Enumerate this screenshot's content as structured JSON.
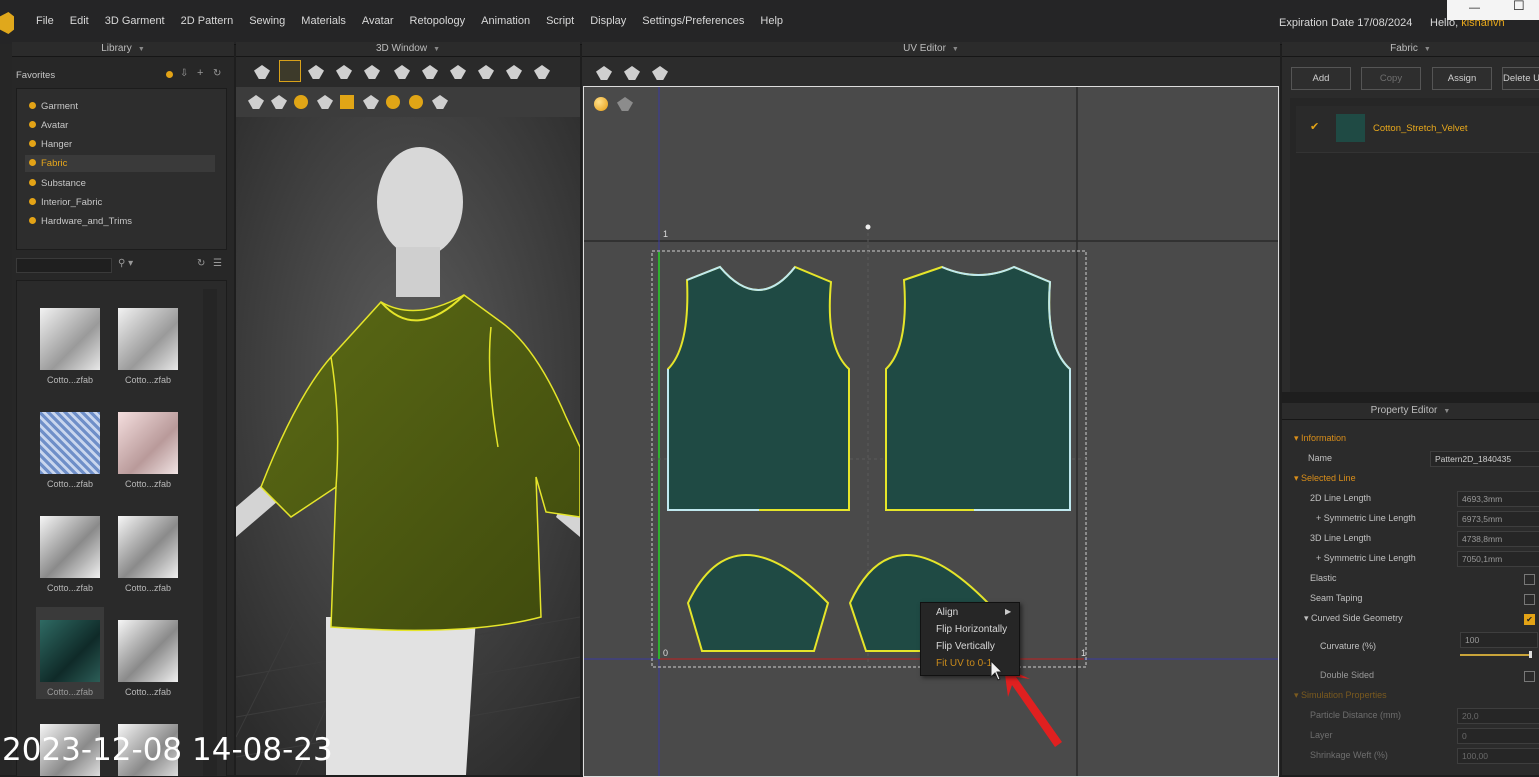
{
  "menubar": {
    "items": [
      "File",
      "Edit",
      "3D Garment",
      "2D Pattern",
      "Sewing",
      "Materials",
      "Avatar",
      "Retopology",
      "Animation",
      "Script",
      "Display",
      "Settings/Preferences",
      "Help"
    ],
    "expiration": "Expiration Date 17/08/2024",
    "hello": "Hello, ",
    "username": "kishanvh"
  },
  "panels": {
    "library_title": "Library",
    "window3d_title": "3D Window",
    "uv_title": "UV Editor",
    "fabric_title": "Fabric",
    "property_title": "Property Editor"
  },
  "library": {
    "favorites_label": "Favorites",
    "favorites": [
      "Garment",
      "Avatar",
      "Hanger",
      "Fabric",
      "Substance",
      "Interior_Fabric",
      "Hardware_and_Trims"
    ],
    "active_favorite": "Fabric",
    "thumbs": [
      "Cotto...zfab",
      "Cotto...zfab",
      "Cotto...zfab",
      "Cotto...zfab",
      "Cotto...zfab",
      "Cotto...zfab",
      "Cotto...zfab",
      "Cotto...zfab"
    ]
  },
  "fabric": {
    "buttons": {
      "add": "Add",
      "copy": "Copy",
      "assign": "Assign",
      "delete": "Delete U"
    },
    "item": "Cotton_Stretch_Velvet"
  },
  "uv": {
    "axis_top": "1",
    "axis_zero": "0",
    "axis_right": "1"
  },
  "context_menu": {
    "align": "Align",
    "flip_h": "Flip Horizontally",
    "flip_v": "Flip Vertically",
    "fit_uv": "Fit UV to 0-1"
  },
  "property": {
    "information": "Information",
    "name_label": "Name",
    "name_value": "Pattern2D_1840435",
    "selected_line": "Selected Line",
    "line2d": "2D Line Length",
    "line2d_val": "4693,3mm",
    "sym1": "+ Symmetric Line Length",
    "sym1_val": "6973,5mm",
    "line3d": "3D Line Length",
    "line3d_val": "4738,8mm",
    "sym2": "+ Symmetric Line Length",
    "sym2_val": "7050,1mm",
    "elastic": "Elastic",
    "seam_taping": "Seam Taping",
    "curved": "Curved Side Geometry",
    "curvature": "Curvature (%)",
    "curvature_val": "100",
    "double_sided": "Double Sided",
    "sim_props": "Simulation Properties",
    "particle": "Particle Distance (mm)",
    "particle_val": "20,0",
    "layer": "Layer",
    "layer_val": "0",
    "shrink_weft": "Shrinkage Weft (%)",
    "shrink_weft_val": "100,00"
  },
  "overlay": {
    "timestamp": "2023-12-08 14-08-23"
  },
  "colors": {
    "accent": "#e8a81c",
    "fabric_green": "#1f4a44",
    "garment_olive": "#4e5c12",
    "outline_yellow": "#e5e52a",
    "outline_cyan": "#bfe8ef"
  }
}
